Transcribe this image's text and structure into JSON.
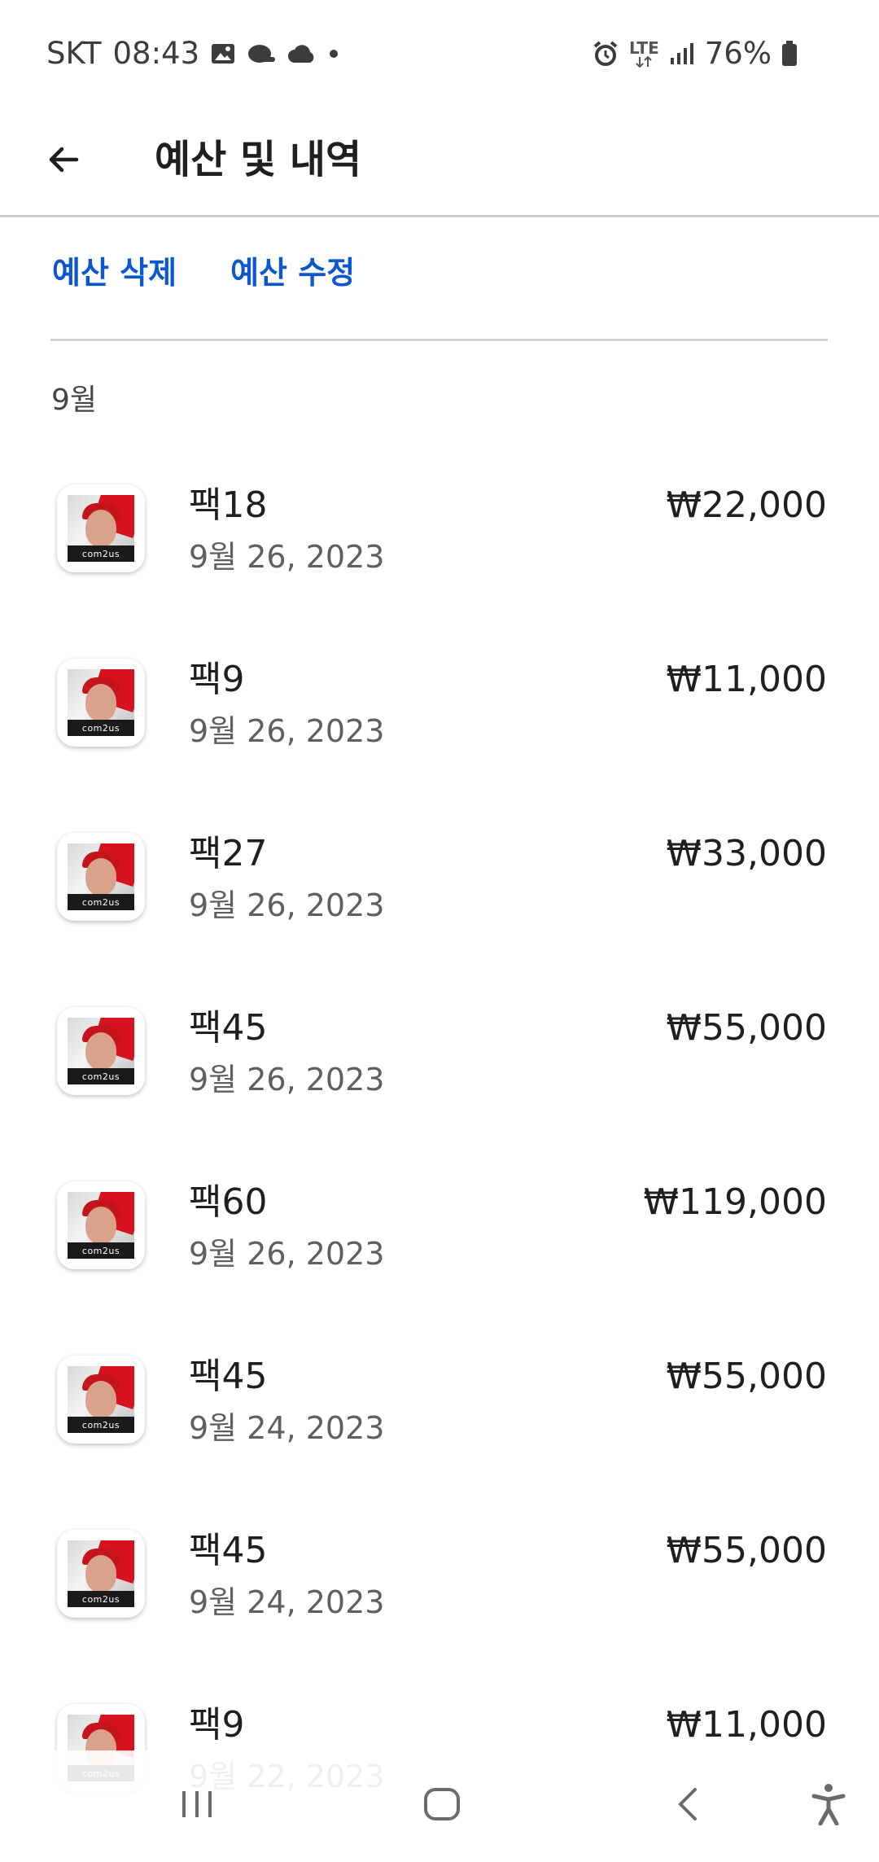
{
  "status_bar": {
    "carrier": "SKT",
    "time": "08:43",
    "network": "LTE",
    "battery": "76%"
  },
  "header": {
    "title": "예산 및 내역"
  },
  "actions": {
    "delete_label": "예산 삭제",
    "edit_label": "예산 수정"
  },
  "month_label": "9월",
  "icon_brand": "com2us",
  "items": [
    {
      "name": "팩18",
      "date": "9월 26, 2023",
      "price": "₩22,000"
    },
    {
      "name": "팩9",
      "date": "9월 26, 2023",
      "price": "₩11,000"
    },
    {
      "name": "팩27",
      "date": "9월 26, 2023",
      "price": "₩33,000"
    },
    {
      "name": "팩45",
      "date": "9월 26, 2023",
      "price": "₩55,000"
    },
    {
      "name": "팩60",
      "date": "9월 26, 2023",
      "price": "₩119,000"
    },
    {
      "name": "팩45",
      "date": "9월 24, 2023",
      "price": "₩55,000"
    },
    {
      "name": "팩45",
      "date": "9월 24, 2023",
      "price": "₩55,000"
    },
    {
      "name": "팩9",
      "date": "9월 22, 2023",
      "price": "₩11,000"
    }
  ],
  "colors": {
    "accent": "#0b57d0",
    "divider": "#d2d2d2",
    "text": "#1f1f1f"
  }
}
